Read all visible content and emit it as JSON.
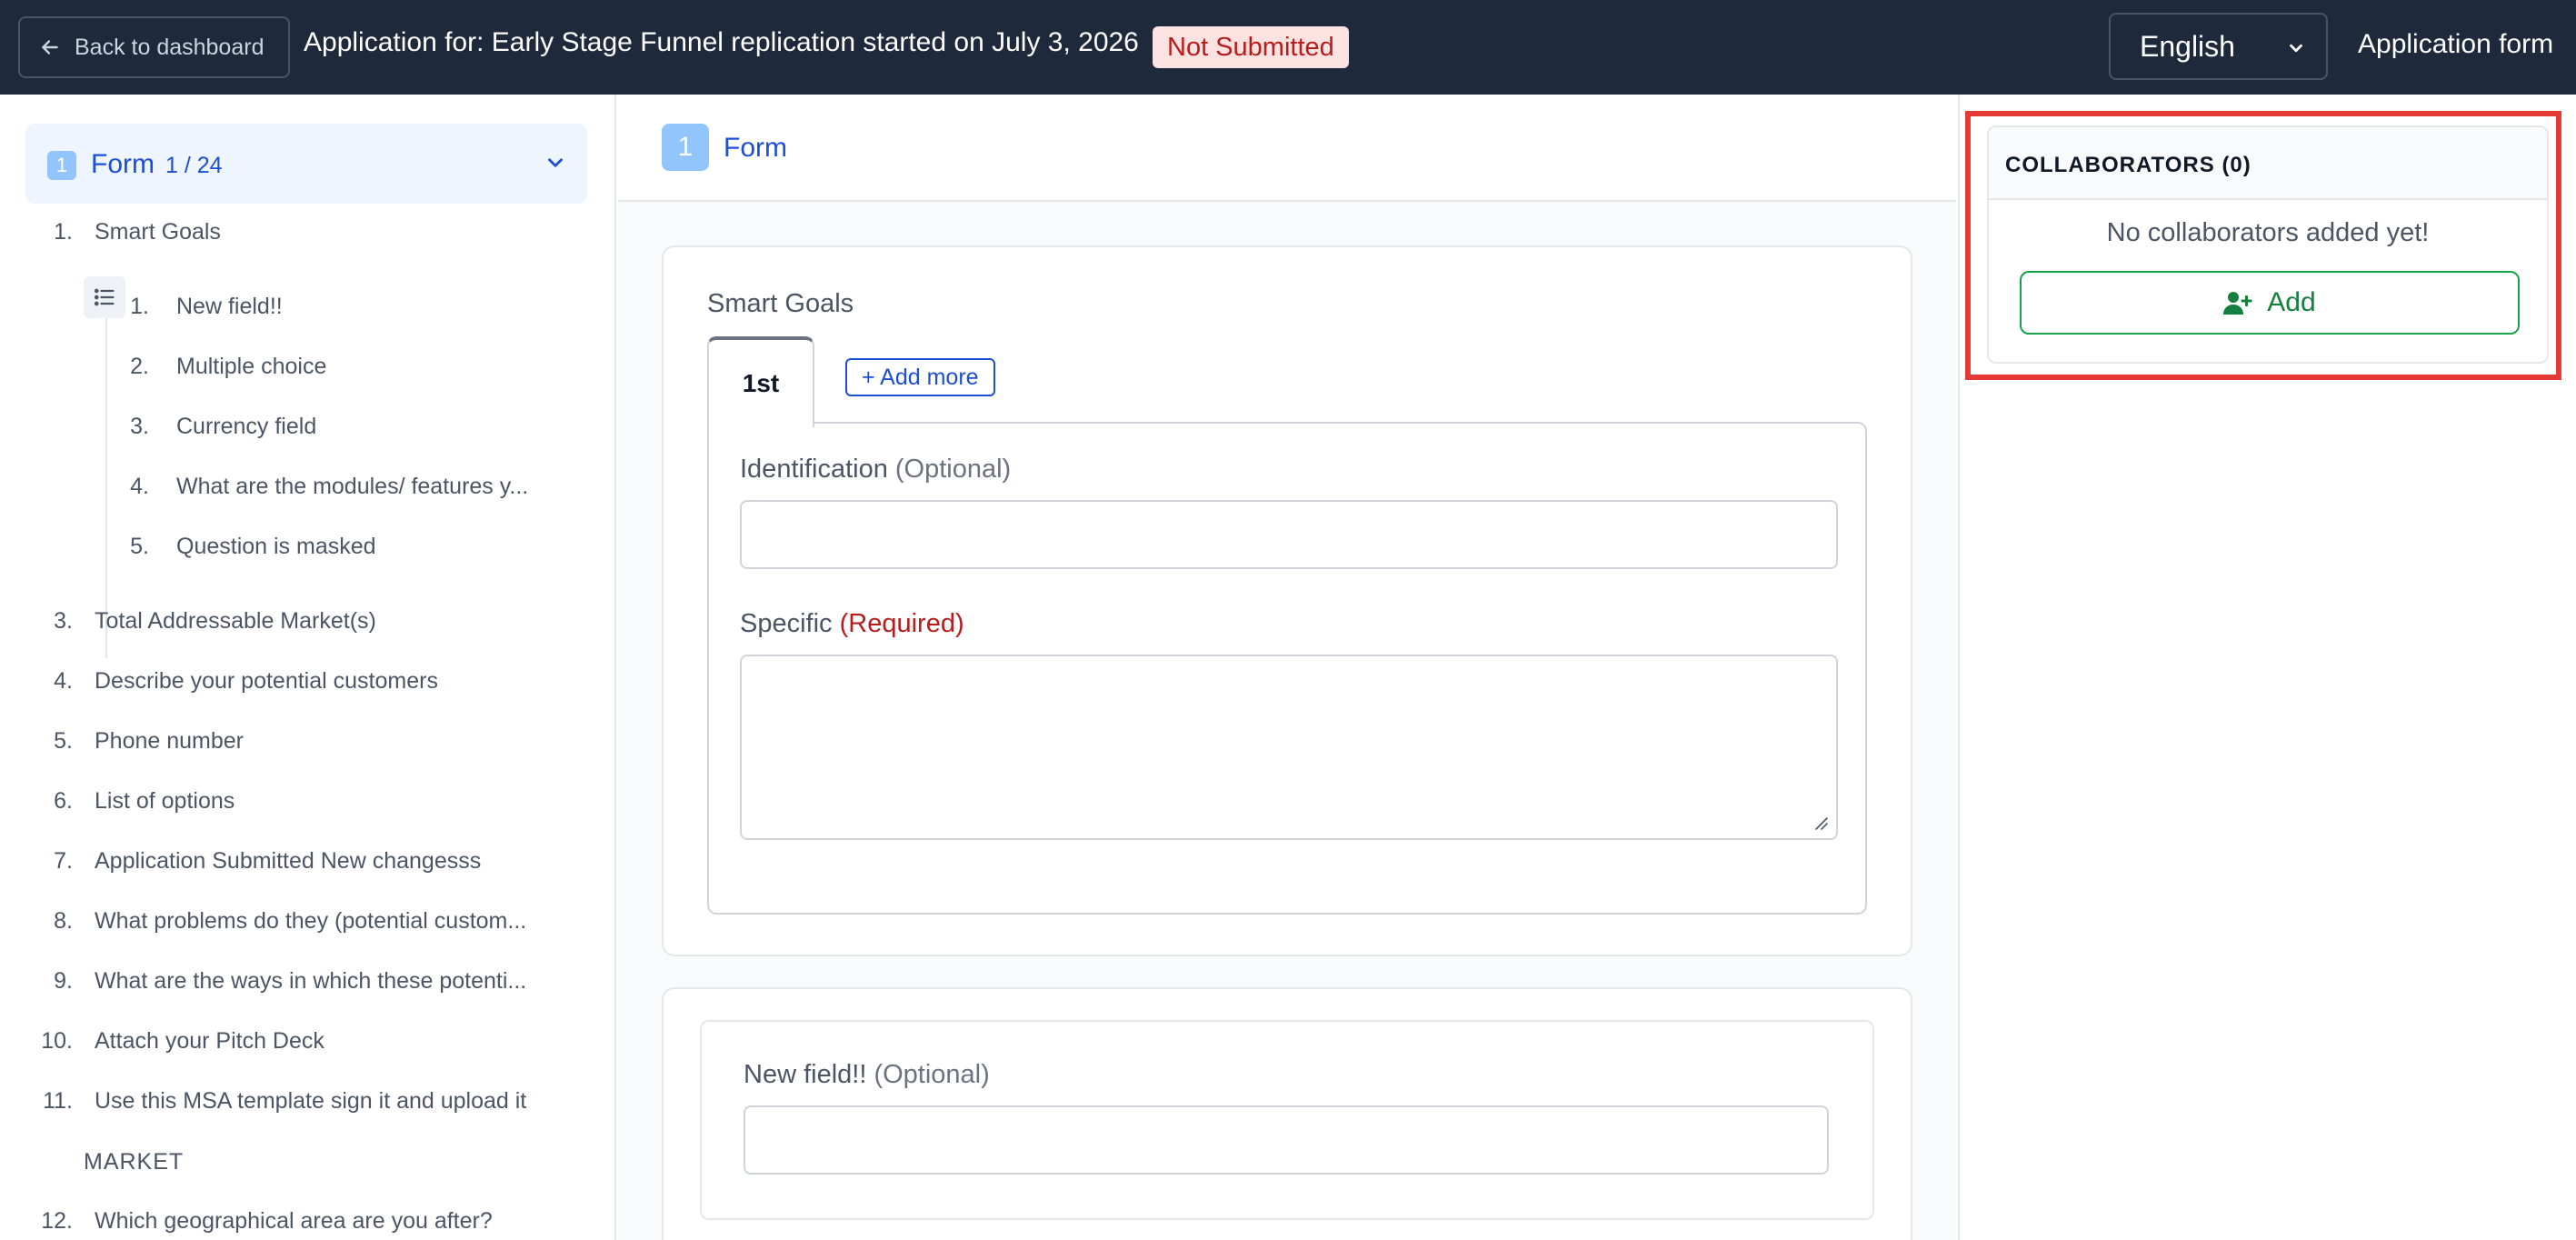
{
  "header": {
    "back_label": "Back to dashboard",
    "title": "Application for: Early Stage Funnel replication started on July 3, 2026",
    "status": "Not Submitted",
    "language": "English",
    "form_link": "Application form"
  },
  "sidebar": {
    "section": {
      "number": "1",
      "label": "Form",
      "count": "1 / 24"
    },
    "items_top": [
      {
        "num": "1.",
        "label": "Smart Goals"
      }
    ],
    "sub_items": [
      {
        "num": "1.",
        "label": "New field!!"
      },
      {
        "num": "2.",
        "label": "Multiple choice"
      },
      {
        "num": "3.",
        "label": "Currency field"
      },
      {
        "num": "4.",
        "label": "What are the modules/ features y..."
      },
      {
        "num": "5.",
        "label": "Question is masked"
      }
    ],
    "items": [
      {
        "num": "3.",
        "label": "Total Addressable Market(s)"
      },
      {
        "num": "4.",
        "label": "Describe your potential customers"
      },
      {
        "num": "5.",
        "label": "Phone number"
      },
      {
        "num": "6.",
        "label": "List of options"
      },
      {
        "num": "7.",
        "label": "Application Submitted New changesss"
      },
      {
        "num": "8.",
        "label": "What problems do they (potential custom..."
      },
      {
        "num": "9.",
        "label": "What are the ways in which these potenti..."
      },
      {
        "num": "10.",
        "label": "Attach your Pitch Deck"
      },
      {
        "num": "11.",
        "label": "Use this MSA template sign it and upload it"
      }
    ],
    "market_heading": "MARKET",
    "items_after": [
      {
        "num": "12.",
        "label": "Which geographical area are you after?"
      }
    ]
  },
  "main": {
    "section_number": "1",
    "section_label": "Form",
    "group_title": "Smart Goals",
    "tab_active": "1st",
    "add_more": "+ Add more",
    "fields": {
      "identification": {
        "label": "Identification",
        "tag": "(Optional)",
        "value": ""
      },
      "specific": {
        "label": "Specific",
        "tag": "(Required)",
        "value": ""
      },
      "new_field": {
        "label": "New field!!",
        "tag": "(Optional)",
        "value": ""
      }
    }
  },
  "collaborators": {
    "title": "COLLABORATORS (0)",
    "empty_text": "No collaborators added yet!",
    "add_label": "Add"
  },
  "colors": {
    "topbar": "#1e293b",
    "accent_blue": "#1d4ed8",
    "required_red": "#b91c1c",
    "add_green": "#15803d",
    "highlight": "#e53935"
  }
}
